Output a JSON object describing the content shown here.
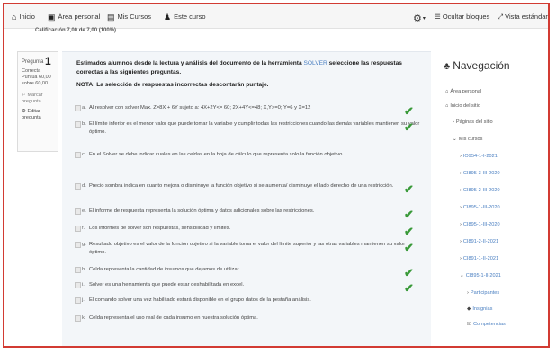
{
  "topnav": {
    "items": [
      {
        "icon": "home-icon",
        "glyph": "⌂",
        "label": "Inicio"
      },
      {
        "icon": "dashboard-icon",
        "glyph": "▣",
        "label": "Área personal"
      },
      {
        "icon": "courses-icon",
        "glyph": "▤",
        "label": "Mis Cursos"
      },
      {
        "icon": "users-icon",
        "glyph": "♟",
        "label": "Este curso"
      }
    ],
    "hide_blocks": "Ocultar bloques",
    "standard_view": "Vista estándar"
  },
  "subhead": "Calificación   7,00 de 7,00 (100%)",
  "question_info": {
    "label": "Pregunta",
    "number": "1",
    "status": "Correcta",
    "score": "Puntúa 60,00 sobre 60,00",
    "flag": "Marcar pregunta",
    "edit": "Editar pregunta"
  },
  "question": {
    "text_a": "Estimados alumnos desde la lectura y análisis del documento de la herramienta ",
    "text_solver": "SOLVER",
    "text_b": " seleccione las respuestas correctas a las siguientes preguntas.",
    "note": "NOTA: La selección de respuestas incorrectas descontarán puntaje.",
    "options": [
      {
        "letter": "a.",
        "text": "Al resolver con solver Max. Z=8X + 6Y sujeto a: 4X+2Y<= 60; 2X+4Y<=48; X,Y>=0; Y=6 y X=12",
        "correct": true
      },
      {
        "letter": "b.",
        "text": "El límite inferior es el menor valor que puede tomar la variable y cumplir todas las restricciones cuando las demás variables mantienen su valor óptimo.",
        "correct": true
      },
      {
        "letter": "c.",
        "text": "En el Solver se debe indicar cuales en las celdas en la hoja de cálculo que representa solo la función objetivo.",
        "correct": false
      },
      {
        "letter": "d.",
        "text": "Precio sombra indica en cuanto mejora o disminuye la función objetivo si se aumenta/ disminuye el lado derecho de una restricción.",
        "correct": true
      },
      {
        "letter": "e.",
        "text": "El informe de respuesta representa la solución óptima y datos adicionales sobre las restricciones.",
        "correct": true
      },
      {
        "letter": "f.",
        "text": "Los informes de solver son respuestas, sensibilidad y límites.",
        "correct": true
      },
      {
        "letter": "g.",
        "text": "Resultado objetivo es el valor de la función objetivo si la variable toma el valor del límite superior y las otras variables mantienen su valor óptimo.",
        "correct": true
      },
      {
        "letter": "h.",
        "text": "Celda representa la cantidad de insumos que dejamos de utilizar.",
        "correct": true
      },
      {
        "letter": "i.",
        "text": "Solver es una herramienta que puede estar deshabilitada en excel.",
        "correct": true
      },
      {
        "letter": "j.",
        "text": "El comando solver una vez habilitado estará disponible en el grupo datos de la pestaña análisis.",
        "correct": false
      },
      {
        "letter": "k.",
        "text": "Celda representa el uso real de cada insumo en nuestra solución óptima.",
        "correct": false
      }
    ]
  },
  "sidebar": {
    "title": "Navegación",
    "items": [
      {
        "label": "Área personal",
        "icon": "home-icon",
        "glyph": "⌂",
        "indent": 0,
        "link": false
      },
      {
        "label": "Inicio del sitio",
        "icon": "home-icon",
        "glyph": "⌂",
        "indent": 0,
        "link": false
      },
      {
        "label": "Páginas del sitio",
        "icon": "chevron-right-icon",
        "glyph": "›",
        "indent": 1,
        "link": false
      },
      {
        "label": "Mis cursos",
        "icon": "chevron-down-icon",
        "glyph": "⌄",
        "indent": 1,
        "link": false
      },
      {
        "label": "IO954-1-I-2021",
        "icon": "chevron-right-icon",
        "glyph": "›",
        "indent": 2,
        "link": true
      },
      {
        "label": "CI895-3-III-2020",
        "icon": "chevron-right-icon",
        "glyph": "›",
        "indent": 2,
        "link": true
      },
      {
        "label": "CI895-2-III-2020",
        "icon": "chevron-right-icon",
        "glyph": "›",
        "indent": 2,
        "link": true
      },
      {
        "label": "CI895-1-III-2020",
        "icon": "chevron-right-icon",
        "glyph": "›",
        "indent": 2,
        "link": true
      },
      {
        "label": "CI895-1-III-2020",
        "icon": "chevron-right-icon",
        "glyph": "›",
        "indent": 2,
        "link": true
      },
      {
        "label": "CI891-2-II-2021",
        "icon": "chevron-right-icon",
        "glyph": "›",
        "indent": 2,
        "link": true
      },
      {
        "label": "CI891-1-II-2021",
        "icon": "chevron-right-icon",
        "glyph": "›",
        "indent": 2,
        "link": true
      },
      {
        "label": "CI895-1-II-2021",
        "icon": "chevron-down-icon",
        "glyph": "⌄",
        "indent": 2,
        "link": true
      },
      {
        "label": "Participantes",
        "icon": "chevron-right-icon",
        "glyph": "›",
        "indent": 3,
        "link": true
      },
      {
        "label": "Insignias",
        "icon": "badge-icon",
        "glyph": "◆",
        "indent": 3,
        "link": true
      },
      {
        "label": "Competencias",
        "icon": "checkbox-icon",
        "glyph": "☑",
        "indent": 3,
        "link": true
      }
    ]
  },
  "colors": {
    "accent": "#4a7fc1",
    "correct": "#3a9a3a",
    "frame": "#d23b33"
  }
}
